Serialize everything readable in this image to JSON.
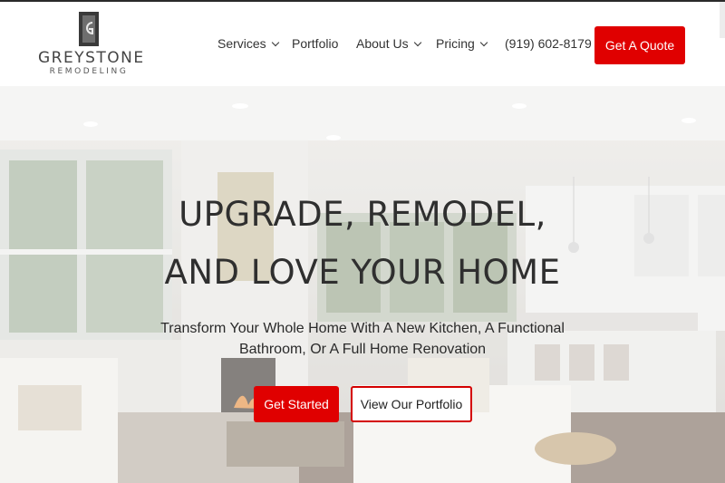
{
  "brand": {
    "name": "GREYSTONE",
    "tagline": "REMODELING",
    "logo_icon": "logo-mark-icon"
  },
  "nav": {
    "items": [
      {
        "label": "Services",
        "has_dropdown": true
      },
      {
        "label": "Portfolio",
        "has_dropdown": false
      },
      {
        "label": "About Us",
        "has_dropdown": true
      },
      {
        "label": "Pricing",
        "has_dropdown": true
      },
      {
        "label": "(919) 602-8179",
        "has_dropdown": false
      }
    ],
    "cta_label": "Get A Quote"
  },
  "hero": {
    "headline_line1": "UPGRADE, REMODEL,",
    "headline_line2": "AND LOVE YOUR HOME",
    "subtitle_line1": "Transform Your Whole Home With A New Kitchen, A Functional",
    "subtitle_line2": "Bathroom, Or A Full Home Renovation",
    "primary_button": "Get Started",
    "secondary_button": "View Our Portfolio"
  },
  "colors": {
    "accent": "#e00000",
    "text": "#2f2f2f"
  }
}
